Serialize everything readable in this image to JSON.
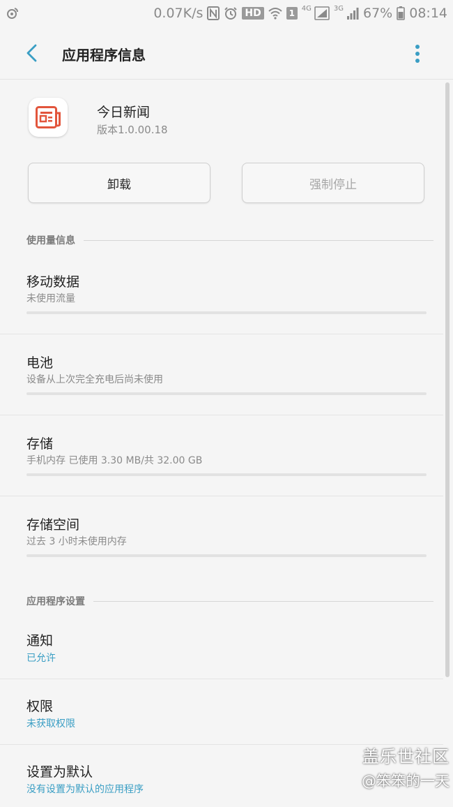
{
  "status_bar": {
    "speed": "0.07K/s",
    "hd": "HD",
    "sim": "1",
    "net1": "4G",
    "net2": "3G",
    "battery": "67%",
    "time": "08:14"
  },
  "header": {
    "title": "应用程序信息"
  },
  "app": {
    "name": "今日新闻",
    "version": "版本1.0.00.18",
    "icon_color": "#e2553c"
  },
  "buttons": {
    "uninstall": "卸载",
    "force_stop": "强制停止"
  },
  "sections": {
    "usage": "使用量信息",
    "settings": "应用程序设置"
  },
  "usage_items": [
    {
      "title": "移动数据",
      "subtitle": "未使用流量"
    },
    {
      "title": "电池",
      "subtitle": "设备从上次完全充电后尚未使用"
    },
    {
      "title": "存储",
      "subtitle": "手机内存 已使用 3.30 MB/共 32.00 GB"
    },
    {
      "title": "存储空间",
      "subtitle": "过去 3 小时未使用内存"
    }
  ],
  "settings_items": [
    {
      "title": "通知",
      "subtitle": "已允许"
    },
    {
      "title": "权限",
      "subtitle": "未获取权限"
    },
    {
      "title": "设置为默认",
      "subtitle": "没有设置为默认的应用程序"
    }
  ],
  "watermark": {
    "line1": "盖乐世社区",
    "line2": "@笨笨的一天"
  },
  "colors": {
    "accent": "#3a9ec4",
    "back_arrow": "#3a9ec4"
  }
}
